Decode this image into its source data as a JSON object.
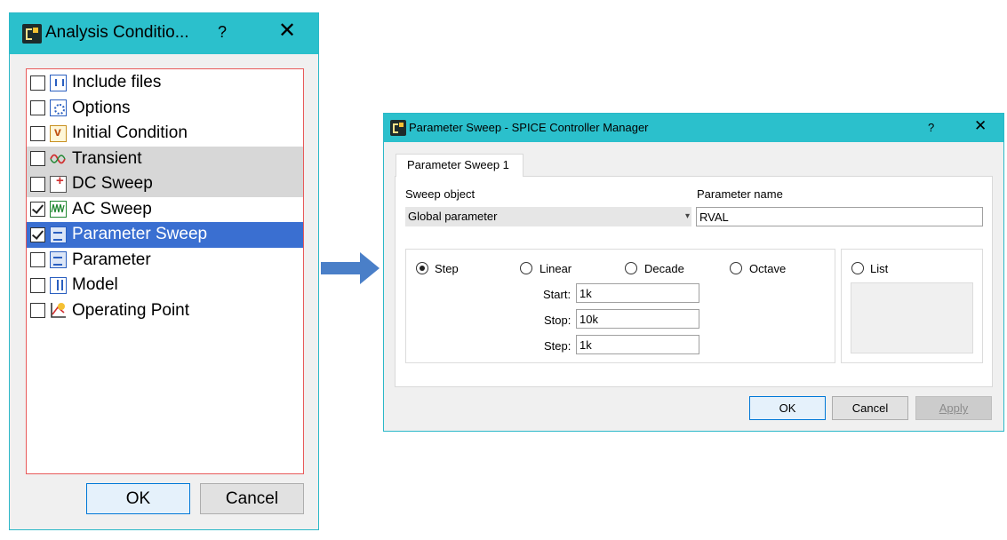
{
  "analysis_dialog": {
    "title": "Analysis Conditio...",
    "help_label": "?",
    "close_label": "✕",
    "items": [
      {
        "label": "Include files",
        "checked": false,
        "state": "normal",
        "icon": "include-file-icon"
      },
      {
        "label": "Options",
        "checked": false,
        "state": "normal",
        "icon": "options-icon"
      },
      {
        "label": "Initial Condition",
        "checked": false,
        "state": "normal",
        "icon": "initial-condition-icon"
      },
      {
        "label": "Transient",
        "checked": false,
        "state": "grey",
        "icon": "transient-wave-icon"
      },
      {
        "label": "DC Sweep",
        "checked": false,
        "state": "grey",
        "icon": "dc-source-icon"
      },
      {
        "label": "AC Sweep",
        "checked": true,
        "state": "normal",
        "icon": "ac-wave-icon"
      },
      {
        "label": "Parameter Sweep",
        "checked": true,
        "state": "selected",
        "icon": "parameter-table-icon"
      },
      {
        "label": "Parameter",
        "checked": false,
        "state": "normal",
        "icon": "parameter-table-icon"
      },
      {
        "label": "Model",
        "checked": false,
        "state": "normal",
        "icon": "model-icon"
      },
      {
        "label": "Operating Point",
        "checked": false,
        "state": "normal",
        "icon": "operating-point-icon"
      }
    ],
    "ok_label": "OK",
    "cancel_label": "Cancel"
  },
  "sweep_dialog": {
    "title": "Parameter Sweep - SPICE Controller Manager",
    "help_label": "?",
    "close_label": "✕",
    "tab_label": "Parameter Sweep 1",
    "sweep_object_label": "Sweep object",
    "sweep_object_value": "Global parameter",
    "parameter_name_label": "Parameter name",
    "parameter_name_value": "RVAL",
    "radio_step": "Step",
    "radio_linear": "Linear",
    "radio_decade": "Decade",
    "radio_octave": "Octave",
    "radio_list": "List",
    "selected_mode": "Step",
    "start_label": "Start:",
    "start_value": "1k",
    "stop_label": "Stop:",
    "stop_value": "10k",
    "step_label": "Step:",
    "step_value": "1k",
    "ok_label": "OK",
    "cancel_label": "Cancel",
    "apply_label": "Apply"
  },
  "colors": {
    "titlebar": "#2bc0cc",
    "selection": "#3a6fd1",
    "arrow": "#4a7fc8",
    "tree_border": "#e85a5a"
  }
}
